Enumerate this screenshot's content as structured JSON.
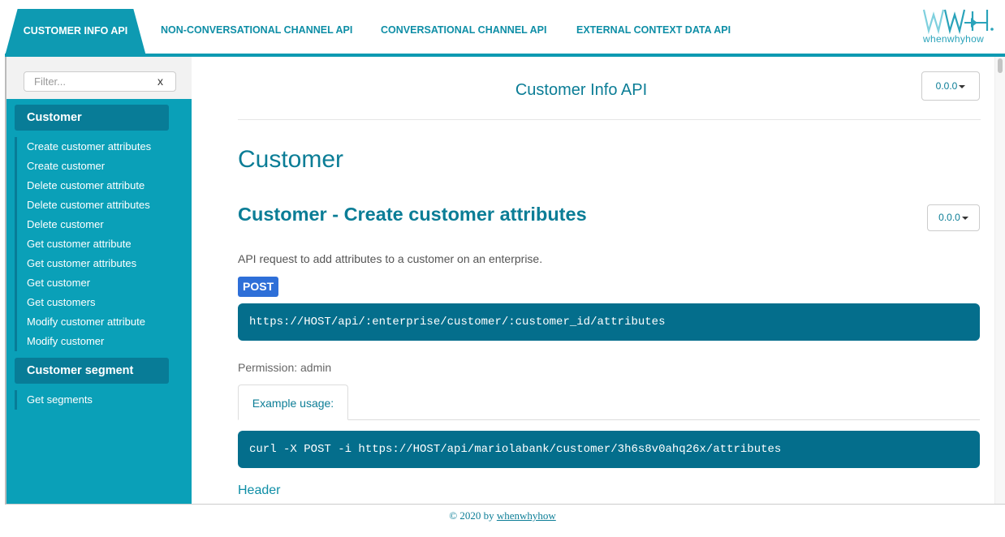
{
  "tabs": [
    {
      "label": "CUSTOMER INFO API",
      "active": true
    },
    {
      "label": "NON-CONVERSATIONAL CHANNEL API",
      "active": false
    },
    {
      "label": "CONVERSATIONAL CHANNEL API",
      "active": false
    },
    {
      "label": "EXTERNAL CONTEXT DATA API",
      "active": false
    }
  ],
  "logo": {
    "text": "whenwhyhow",
    "icon": "wwh-logo"
  },
  "sidebar": {
    "filter_placeholder": "Filter...",
    "filter_clear": "x",
    "groups": [
      {
        "title": "Customer",
        "items": [
          "Create customer attributes",
          "Create customer",
          "Delete customer attribute",
          "Delete customer attributes",
          "Delete customer",
          "Get customer attribute",
          "Get customer attributes",
          "Get customer",
          "Get customers",
          "Modify customer attribute",
          "Modify customer"
        ]
      },
      {
        "title": "Customer segment",
        "items": [
          "Get segments"
        ]
      }
    ]
  },
  "main": {
    "page_title": "Customer Info API",
    "version": "0.0.0",
    "section_title": "Customer",
    "endpoint": {
      "title": "Customer - Create customer attributes",
      "version": "0.0.0",
      "description": "API request to add attributes to a customer on an enterprise.",
      "method": "POST",
      "url": "https://HOST/api/:enterprise/customer/:customer_id/attributes",
      "permission": "Permission: admin",
      "example_tab": "Example usage:",
      "example": "curl -X POST -i https://HOST/api/mariolabank/customer/3h6s8v0ahq26x/attributes",
      "next_heading": "Header"
    }
  },
  "footer": {
    "prefix": "© 2020 by",
    "link": "whenwhyhow"
  },
  "colors": {
    "accent": "#0aa0b8",
    "dark_accent": "#087c97",
    "code_bg": "#046e8c",
    "post": "#2e6fd8"
  }
}
